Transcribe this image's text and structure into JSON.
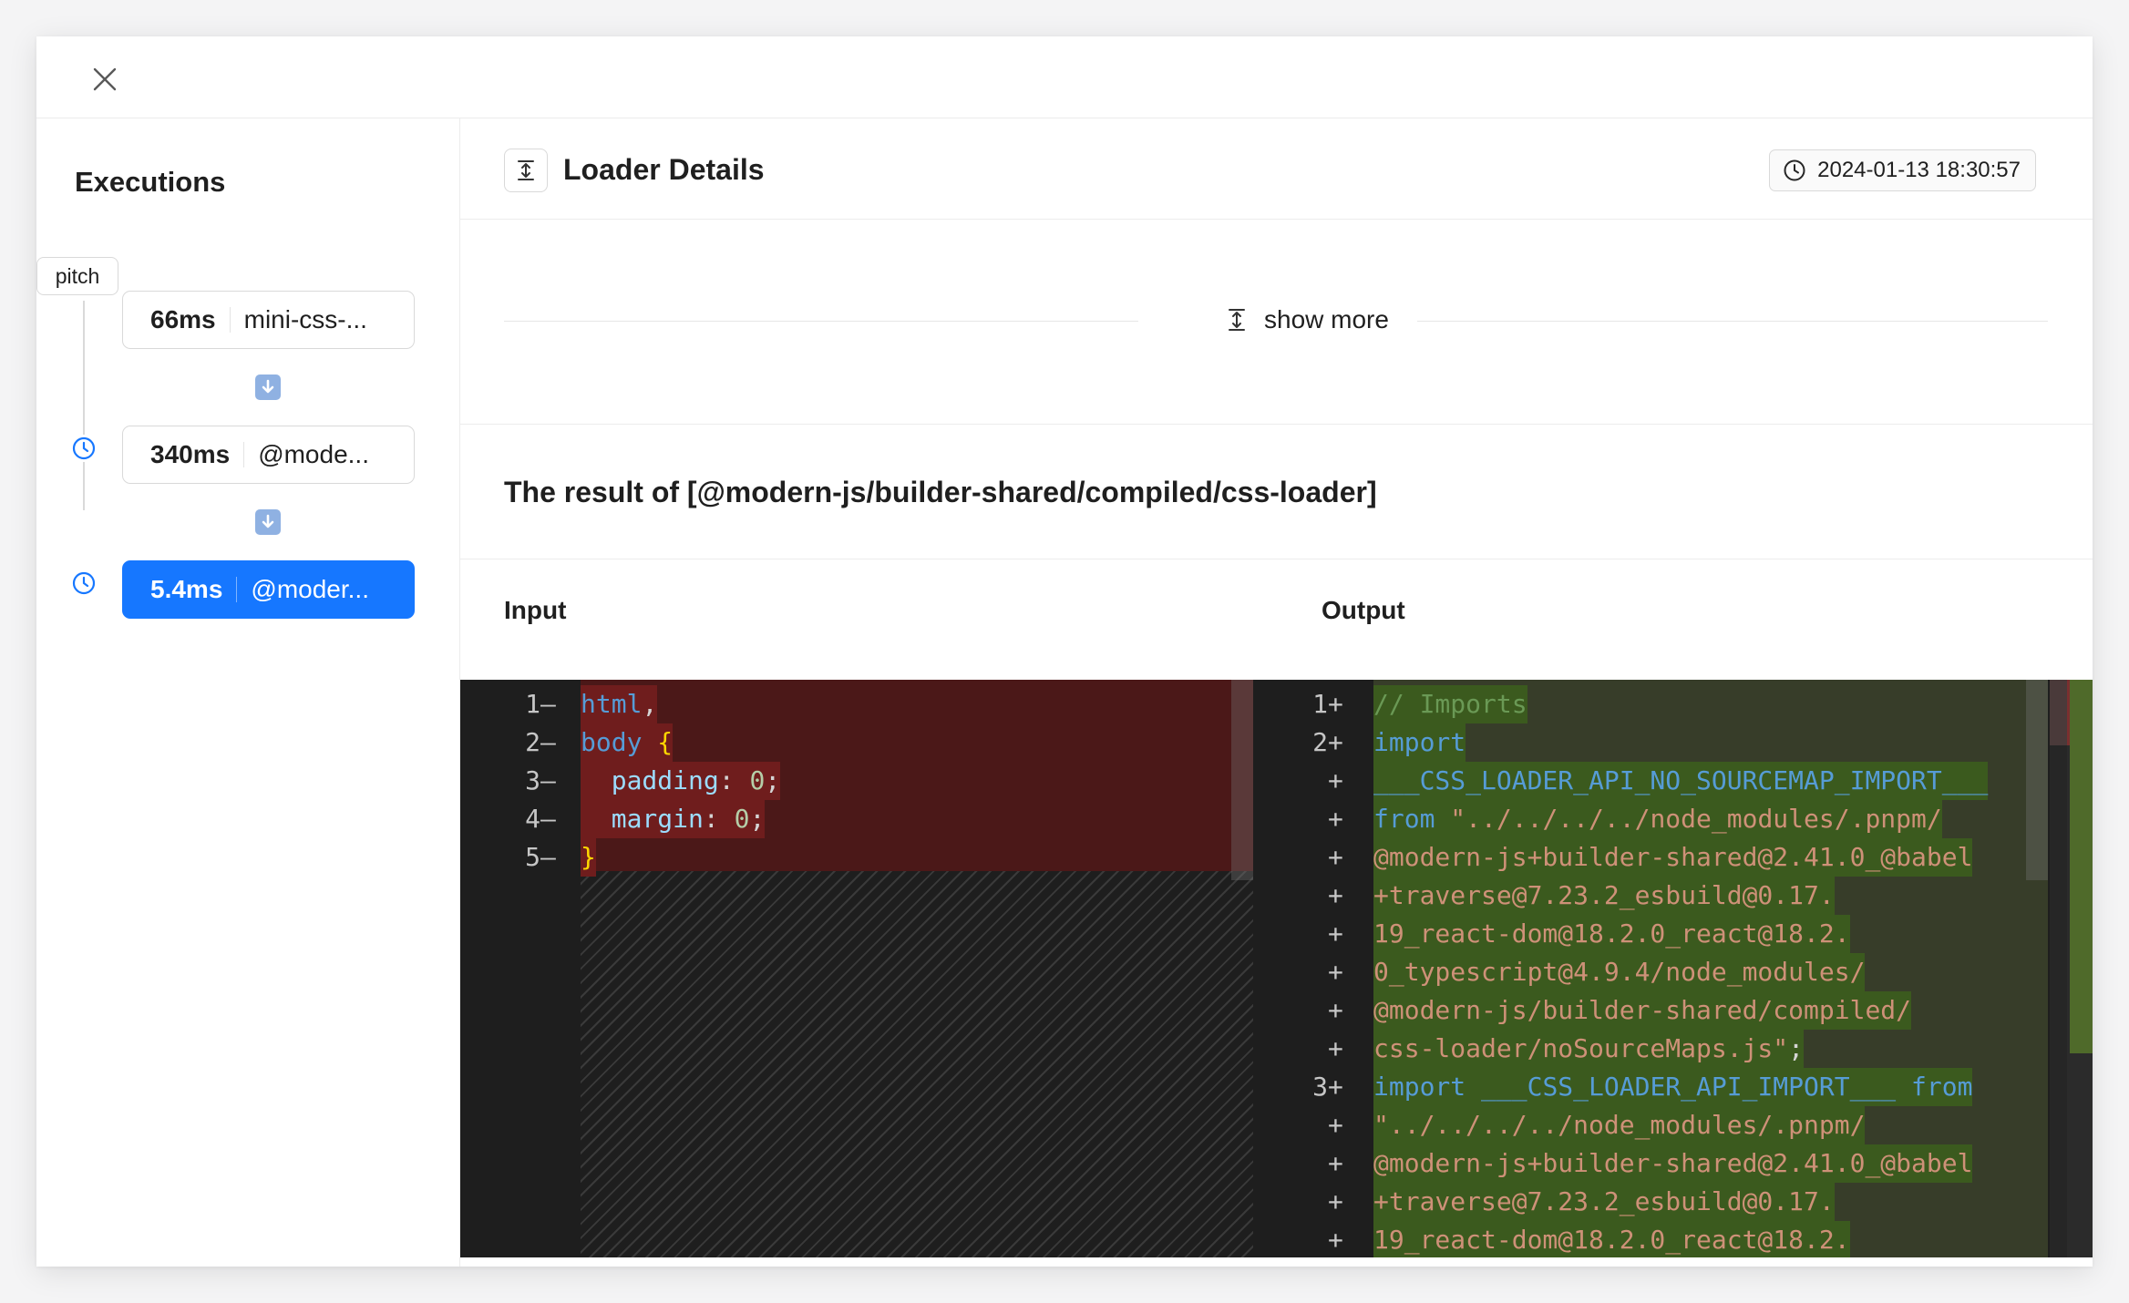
{
  "sidebar": {
    "title": "Executions",
    "pitch_tag": "pitch",
    "executions": [
      {
        "duration": "66ms",
        "name": "mini-css-...",
        "active": false
      },
      {
        "duration": "340ms",
        "name": "@mode...",
        "active": false
      },
      {
        "duration": "5.4ms",
        "name": "@moder...",
        "active": true
      }
    ]
  },
  "header": {
    "title": "Loader Details",
    "timestamp": "2024-01-13 18:30:57"
  },
  "show_more": "show more",
  "result_title": "The result of [@modern-js/builder-shared/compiled/css-loader]",
  "input_label": "Input",
  "output_label": "Output",
  "diff": {
    "input_lines": [
      {
        "num": "1",
        "marker": "—",
        "tokens": [
          {
            "t": "html",
            "c": "t-kw"
          },
          {
            "t": ",",
            "c": "t-plain"
          }
        ]
      },
      {
        "num": "2",
        "marker": "—",
        "tokens": [
          {
            "t": "body ",
            "c": "t-kw"
          },
          {
            "t": "{",
            "c": "t-brace"
          }
        ]
      },
      {
        "num": "3",
        "marker": "—",
        "tokens": [
          {
            "t": "  padding",
            "c": "t-prop"
          },
          {
            "t": ": ",
            "c": "t-plain"
          },
          {
            "t": "0",
            "c": "t-num"
          },
          {
            "t": ";",
            "c": "t-plain"
          }
        ]
      },
      {
        "num": "4",
        "marker": "—",
        "tokens": [
          {
            "t": "  margin",
            "c": "t-prop"
          },
          {
            "t": ": ",
            "c": "t-plain"
          },
          {
            "t": "0",
            "c": "t-num"
          },
          {
            "t": ";",
            "c": "t-plain"
          }
        ]
      },
      {
        "num": "5",
        "marker": "—",
        "tokens": [
          {
            "t": "}",
            "c": "t-brace"
          }
        ]
      }
    ],
    "output_lines": [
      {
        "num": "1",
        "marker": "+",
        "tokens": [
          {
            "t": "// Imports",
            "c": "t-cm"
          }
        ]
      },
      {
        "num": "2",
        "marker": "+",
        "tokens": [
          {
            "t": "import",
            "c": "t-kw"
          }
        ]
      },
      {
        "num": "",
        "marker": "+",
        "tokens": [
          {
            "t": "___CSS_LOADER_API_NO_SOURCEMAP_IMPORT___",
            "c": "t-kw"
          }
        ]
      },
      {
        "num": "",
        "marker": "+",
        "tokens": [
          {
            "t": "from ",
            "c": "t-kw"
          },
          {
            "t": "\"../../../../node_modules/.pnpm/",
            "c": "t-str"
          }
        ]
      },
      {
        "num": "",
        "marker": "+",
        "tokens": [
          {
            "t": "@modern-js+builder-shared@2.41.0_@babel",
            "c": "t-str"
          }
        ]
      },
      {
        "num": "",
        "marker": "+",
        "tokens": [
          {
            "t": "+traverse@7.23.2_esbuild@0.17.",
            "c": "t-str"
          }
        ]
      },
      {
        "num": "",
        "marker": "+",
        "tokens": [
          {
            "t": "19_react-dom@18.2.0_react@18.2.",
            "c": "t-str"
          }
        ]
      },
      {
        "num": "",
        "marker": "+",
        "tokens": [
          {
            "t": "0_typescript@4.9.4/node_modules/",
            "c": "t-str"
          }
        ]
      },
      {
        "num": "",
        "marker": "+",
        "tokens": [
          {
            "t": "@modern-js/builder-shared/compiled/",
            "c": "t-str"
          }
        ]
      },
      {
        "num": "",
        "marker": "+",
        "tokens": [
          {
            "t": "css-loader/noSourceMaps.js\"",
            "c": "t-str"
          },
          {
            "t": ";",
            "c": "t-plain"
          }
        ]
      },
      {
        "num": "3",
        "marker": "+",
        "tokens": [
          {
            "t": "import ",
            "c": "t-kw"
          },
          {
            "t": "___CSS_LOADER_API_IMPORT___ ",
            "c": "t-kw"
          },
          {
            "t": "from",
            "c": "t-kw"
          }
        ]
      },
      {
        "num": "",
        "marker": "+",
        "tokens": [
          {
            "t": "\"../../../../node_modules/.pnpm/",
            "c": "t-str"
          }
        ]
      },
      {
        "num": "",
        "marker": "+",
        "tokens": [
          {
            "t": "@modern-js+builder-shared@2.41.0_@babel",
            "c": "t-str"
          }
        ]
      },
      {
        "num": "",
        "marker": "+",
        "tokens": [
          {
            "t": "+traverse@7.23.2_esbuild@0.17.",
            "c": "t-str"
          }
        ]
      },
      {
        "num": "",
        "marker": "+",
        "tokens": [
          {
            "t": "19_react-dom@18.2.0_react@18.2.",
            "c": "t-str"
          }
        ]
      }
    ]
  },
  "colors": {
    "accent": "#1677ff",
    "deleted_bg": "#4b1818",
    "added_bg": "#373d29",
    "editor_bg": "#1e1e1e"
  },
  "icons": {
    "close": "close-icon",
    "clock": "clock-icon",
    "arrow_down": "arrow-down-emoji-icon",
    "expand": "expand-vertical-icon"
  }
}
